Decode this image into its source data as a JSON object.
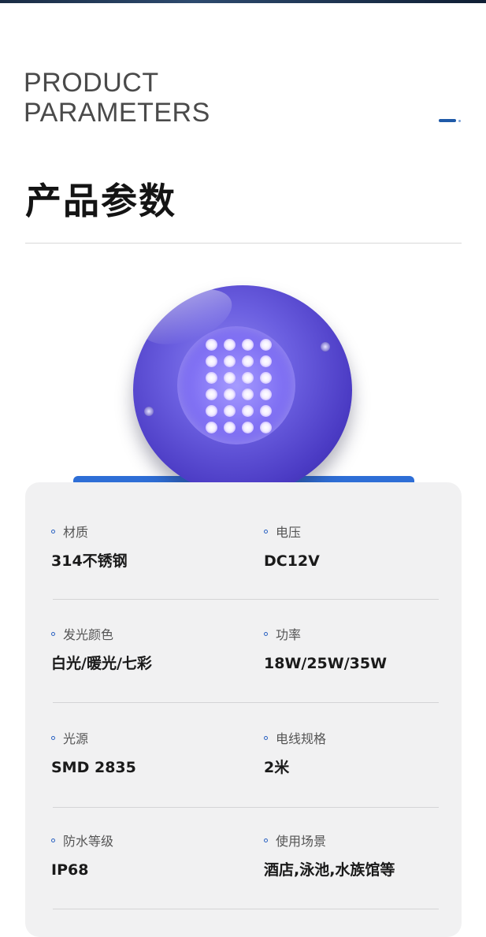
{
  "header": {
    "en_title_line1": "PRODUCT",
    "en_title_line2": "PARAMETERS",
    "cn_title": "产品参数"
  },
  "product_image": {
    "icon": "underwater-led-light",
    "led_color": "#7c6cf2"
  },
  "accent_color": "#2a62c2",
  "params": [
    {
      "label": "材质",
      "value": "314不锈钢"
    },
    {
      "label": "电压",
      "value": "DC12V"
    },
    {
      "label": "发光颜色",
      "value": "白光/暖光/七彩"
    },
    {
      "label": "功率",
      "value": "18W/25W/35W"
    },
    {
      "label": "光源",
      "value": "SMD 2835"
    },
    {
      "label": "电线规格",
      "value": "2米"
    },
    {
      "label": "防水等级",
      "value": "IP68"
    },
    {
      "label": "使用场景",
      "value": "酒店,泳池,水族馆等"
    }
  ]
}
